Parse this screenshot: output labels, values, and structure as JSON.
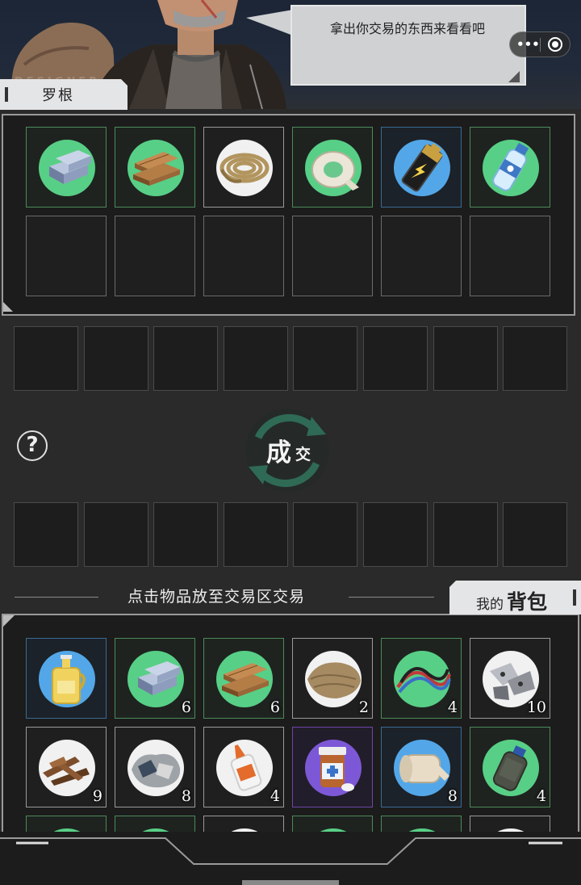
{
  "npc": {
    "name": "罗根",
    "dialogue": "拿出你交易的东西来看看吧",
    "watermark": "DESIGNER"
  },
  "capsule": {
    "more_icon": "more-dots-icon",
    "close_icon": "record-circle-icon"
  },
  "merchant_items": [
    {
      "icon": "steel-ingot-icon",
      "rarity": "green"
    },
    {
      "icon": "wood-planks-icon",
      "rarity": "green"
    },
    {
      "icon": "rope-coil-icon",
      "rarity": "white"
    },
    {
      "icon": "tape-roll-icon",
      "rarity": "green"
    },
    {
      "icon": "battery-icon",
      "rarity": "blue"
    },
    {
      "icon": "water-bottle-icon",
      "rarity": "green"
    }
  ],
  "trade": {
    "deal_label_big": "成",
    "deal_label_small": "交",
    "help_label": "?",
    "hint": "点击物品放至交易区交易"
  },
  "backpack": {
    "title_small": "我的",
    "title_big": "背包",
    "items": [
      {
        "icon": "oil-bottle-icon",
        "rarity": "blue",
        "qty": ""
      },
      {
        "icon": "steel-ingot-icon",
        "rarity": "green",
        "qty": "6"
      },
      {
        "icon": "wood-planks-icon",
        "rarity": "green",
        "qty": "6"
      },
      {
        "icon": "cloth-bundle-icon",
        "rarity": "white",
        "qty": "2"
      },
      {
        "icon": "wires-icon",
        "rarity": "green",
        "qty": "4"
      },
      {
        "icon": "scrap-metal-icon",
        "rarity": "white",
        "qty": "10"
      },
      {
        "icon": "broken-wood-icon",
        "rarity": "white",
        "qty": "9"
      },
      {
        "icon": "rags-icon",
        "rarity": "white",
        "qty": "8"
      },
      {
        "icon": "glue-bottle-icon",
        "rarity": "white",
        "qty": "4"
      },
      {
        "icon": "medicine-bottle-icon",
        "rarity": "purple",
        "qty": ""
      },
      {
        "icon": "bandage-icon",
        "rarity": "blue",
        "qty": "8"
      },
      {
        "icon": "canteen-icon",
        "rarity": "green",
        "qty": "4"
      },
      {
        "icon": "partial-item-icon",
        "rarity": "green",
        "qty": ""
      },
      {
        "icon": "partial-item-icon",
        "rarity": "green",
        "qty": ""
      },
      {
        "icon": "mushroom-icon",
        "rarity": "white",
        "qty": ""
      },
      {
        "icon": "eggs-icon",
        "rarity": "green",
        "qty": ""
      },
      {
        "icon": "partial-item-icon",
        "rarity": "green",
        "qty": ""
      },
      {
        "icon": "partial-item-icon",
        "rarity": "white",
        "qty": ""
      }
    ]
  }
}
